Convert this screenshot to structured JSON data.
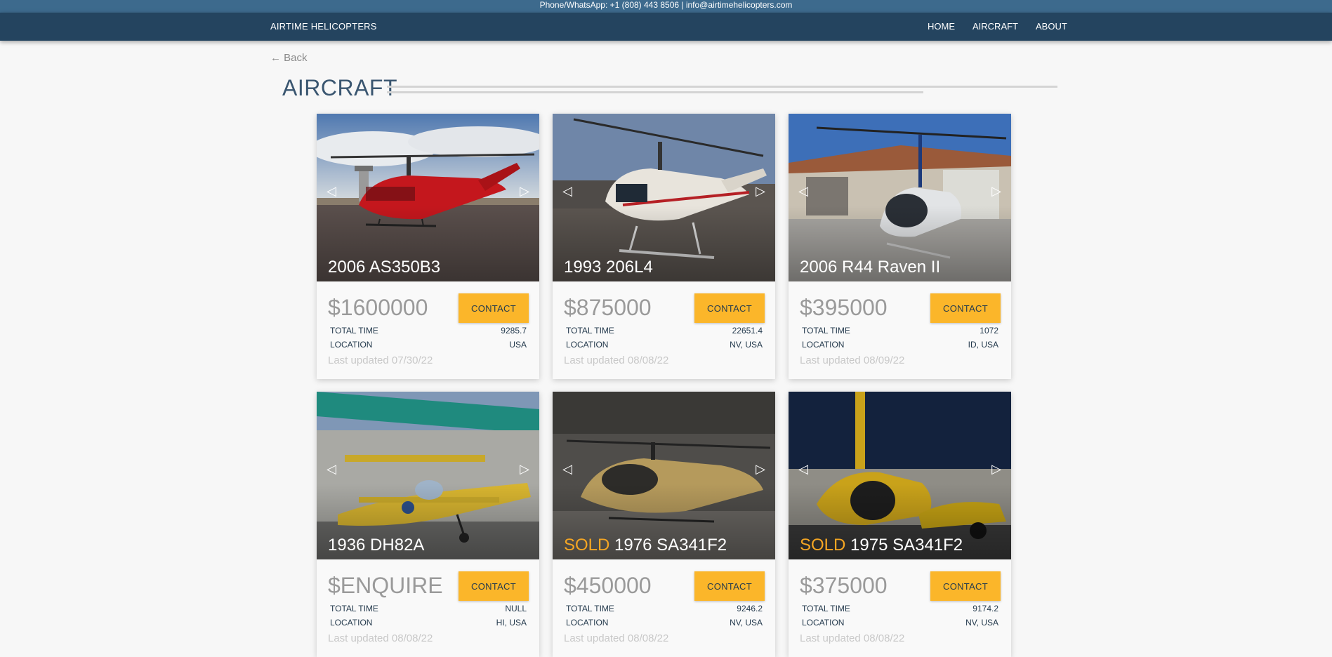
{
  "topbar": {
    "text": "Phone/WhatsApp: +1 (808) 443 8506 | info@airtimehelicopters.com"
  },
  "nav": {
    "brand": "AIRTIME HELICOPTERS",
    "links": [
      "HOME",
      "AIRCRAFT",
      "ABOUT"
    ]
  },
  "back_label": "← Back",
  "page_title": "AIRCRAFT",
  "labels": {
    "contact": "CONTACT",
    "total_time": "TOTAL TIME",
    "location": "LOCATION",
    "prev": "◁",
    "next": "▷"
  },
  "colors": {
    "topbar": "#3d6a8d",
    "navbar": "#24445f",
    "contact_button": "#fbb62a",
    "sold": "#f5a623"
  },
  "aircraft": [
    {
      "sold": "",
      "title": "2006 AS350B3",
      "price": "$1600000",
      "total_time": "9285.7",
      "location": "USA",
      "updated": "Last updated 07/30/22"
    },
    {
      "sold": "",
      "title": "1993 206L4",
      "price": "$875000",
      "total_time": "22651.4",
      "location": "NV, USA",
      "updated": "Last updated 08/08/22"
    },
    {
      "sold": "",
      "title": "2006 R44 Raven II",
      "price": "$395000",
      "total_time": "1072",
      "location": "ID, USA",
      "updated": "Last updated 08/09/22"
    },
    {
      "sold": "",
      "title": "1936 DH82A",
      "price": "$ENQUIRE",
      "total_time": "NULL",
      "location": "HI, USA",
      "updated": "Last updated 08/08/22"
    },
    {
      "sold": "SOLD",
      "title": "1976 SA341F2",
      "price": "$450000",
      "total_time": "9246.2",
      "location": "NV, USA",
      "updated": "Last updated 08/08/22"
    },
    {
      "sold": "SOLD",
      "title": "1975 SA341F2",
      "price": "$375000",
      "total_time": "9174.2",
      "location": "NV, USA",
      "updated": "Last updated 08/08/22"
    }
  ]
}
